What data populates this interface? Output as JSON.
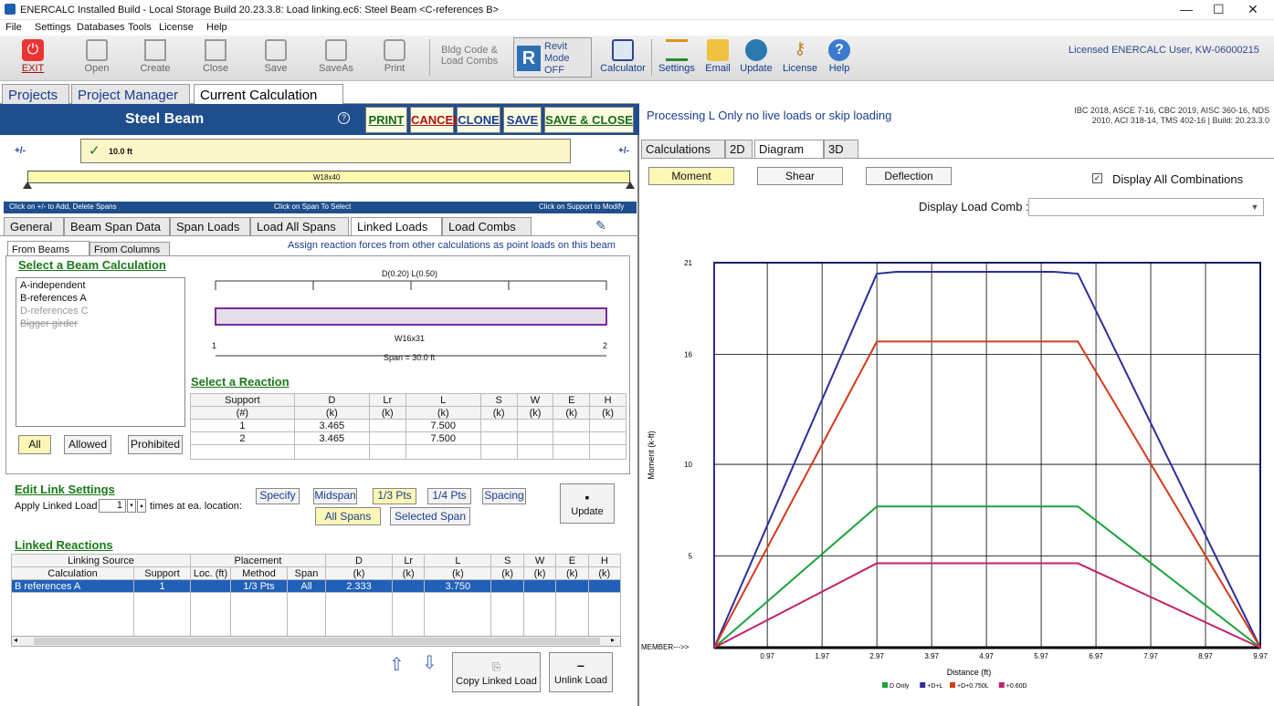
{
  "window": {
    "title": "ENERCALC Installed Build - Local Storage Build 20.23.3.8: Load linking.ec6: Steel Beam <C-references B>",
    "min": "—",
    "max": "☐",
    "close": "✕"
  },
  "menu": [
    "File",
    "Settings",
    "Databases",
    "Tools",
    "License",
    "Help"
  ],
  "toolbar": {
    "exit": "EXIT",
    "open": "Open",
    "create": "Create",
    "close": "Close",
    "save": "Save",
    "saveas": "SaveAs",
    "print": "Print",
    "bldg": "Bldg Code &",
    "bldg2": "Load Combs",
    "revit": "Revit",
    "revit2": "Mode",
    "revit3": "OFF",
    "calculator": "Calculator",
    "settings": "Settings",
    "email": "Email",
    "update": "Update",
    "license": "License",
    "help": "Help",
    "licensed": "Licensed ENERCALC User, KW-06000215"
  },
  "ptabs": [
    "Projects",
    "Project Manager",
    "Current Calculation"
  ],
  "calc": {
    "title": "Steel Beam",
    "help": "?",
    "print": "PRINT",
    "cancel": "CANCEL",
    "clone": "CLONE",
    "save": "SAVE",
    "saveclose": "SAVE & CLOSE"
  },
  "span": {
    "plusminus": "+/-",
    "length": "10.0 ft",
    "check": "✓",
    "beam": "W18x40"
  },
  "hints": {
    "left": "Click on +/- to Add, Delete Spans",
    "mid": "Click on Span To Select",
    "right": "Click on Support to Modify"
  },
  "subtabs": [
    "General",
    "Beam Span Data",
    "Span Loads",
    "Load All Spans",
    "Linked Loads",
    "Load Combs"
  ],
  "linked": {
    "tabs": [
      "From Beams",
      "From Columns"
    ],
    "assign": "Assign reaction forces from other calculations as point loads on this beam",
    "select_beam": "Select a Beam Calculation",
    "beams": [
      "A-independent",
      "B-references A",
      "D-references C",
      "Bigger girder"
    ],
    "load_label": "D(0.20) L(0.50)",
    "section": "W16x31",
    "span_label": "Span = 30.0 ft",
    "sup1": "1",
    "sup2": "2",
    "select_reaction": "Select a Reaction",
    "react_head": [
      "Support",
      "D",
      "Lr",
      "L",
      "S",
      "W",
      "E",
      "H"
    ],
    "react_units": [
      "(#)",
      "(k)",
      "(k)",
      "(k)",
      "(k)",
      "(k)",
      "(k)",
      "(k)"
    ],
    "react_rows": [
      [
        "1",
        "3.465",
        "",
        "7.500",
        "",
        "",
        "",
        ""
      ],
      [
        "2",
        "3.465",
        "",
        "7.500",
        "",
        "",
        "",
        ""
      ]
    ],
    "filters": [
      "All",
      "Allowed",
      "Prohibited"
    ]
  },
  "edit": {
    "title": "Edit Link Settings",
    "apply": "Apply Linked Load",
    "times": "1",
    "times_txt": "times at ea. location:",
    "specify": "Specify",
    "midspan": "Midspan",
    "third": "1/3 Pts",
    "quarter": "1/4 Pts",
    "spacing": "Spacing",
    "allspans": "All Spans",
    "selspan": "Selected Span",
    "update": "Update"
  },
  "linkedr": {
    "title": "Linked Reactions",
    "grp1": "Linking Source",
    "grp2": "Placement",
    "head": [
      "Calculation",
      "Support",
      "Loc. (ft)",
      "Method",
      "Span",
      "(k)",
      "(k)",
      "(k)",
      "(k)",
      "(k)",
      "(k)",
      "(k)"
    ],
    "loads": [
      "D",
      "Lr",
      "L",
      "S",
      "W",
      "E",
      "H"
    ],
    "rows": [
      [
        "B references A",
        "1",
        "",
        "1/3 Pts",
        "All",
        "2.333",
        "",
        "3.750",
        "",
        "",
        "",
        ""
      ]
    ],
    "copy": "Copy Linked Load",
    "unlink": "Unlink Load"
  },
  "right": {
    "processing": "Processing L Only no live loads or skip loading",
    "codes1": "IBC 2018, ASCE 7-16, CBC 2019, AISC 360-16, NDS",
    "codes2": "2010, ACI 318-14, TMS 402-16 | Build: 20.23.3.0",
    "tabs": [
      "Calculations",
      "2D",
      "Diagram",
      "3D"
    ],
    "moment": "Moment",
    "shear": "Shear",
    "deflection": "Deflection",
    "display_all": "Display All Combinations",
    "check": "✓",
    "load_comb": "Display Load Comb :"
  },
  "chart_data": {
    "type": "line",
    "xlabel": "Distance (ft)",
    "ylabel": "Moment (k-ft)",
    "member": "MEMBER--->>",
    "ylim": [
      0,
      21
    ],
    "xlim": [
      0,
      9.97
    ],
    "yticks": [
      5,
      10,
      16,
      21
    ],
    "xticks": [
      0.97,
      1.97,
      2.97,
      3.97,
      4.97,
      5.97,
      6.97,
      7.97,
      8.97,
      9.97
    ],
    "series": [
      {
        "name": "D Only",
        "color": "#1aa33a",
        "x": [
          0,
          2.97,
          3.33,
          6.2,
          6.64,
          9.97
        ],
        "y": [
          0,
          7.7,
          7.7,
          7.7,
          7.7,
          0
        ]
      },
      {
        "name": "+D+L",
        "color": "#2b2f9a",
        "x": [
          0,
          2.97,
          3.33,
          6.2,
          6.64,
          9.97
        ],
        "y": [
          0,
          20.4,
          20.5,
          20.5,
          20.4,
          0
        ]
      },
      {
        "name": "+D+0.750L",
        "color": "#d43a1e",
        "x": [
          0,
          2.97,
          3.33,
          6.2,
          6.64,
          9.97
        ],
        "y": [
          0,
          16.7,
          16.7,
          16.7,
          16.7,
          0
        ]
      },
      {
        "name": "+0.60D",
        "color": "#c0246a",
        "x": [
          0,
          2.97,
          3.33,
          6.2,
          6.64,
          9.97
        ],
        "y": [
          0,
          4.6,
          4.6,
          4.6,
          4.6,
          0
        ]
      }
    ]
  }
}
